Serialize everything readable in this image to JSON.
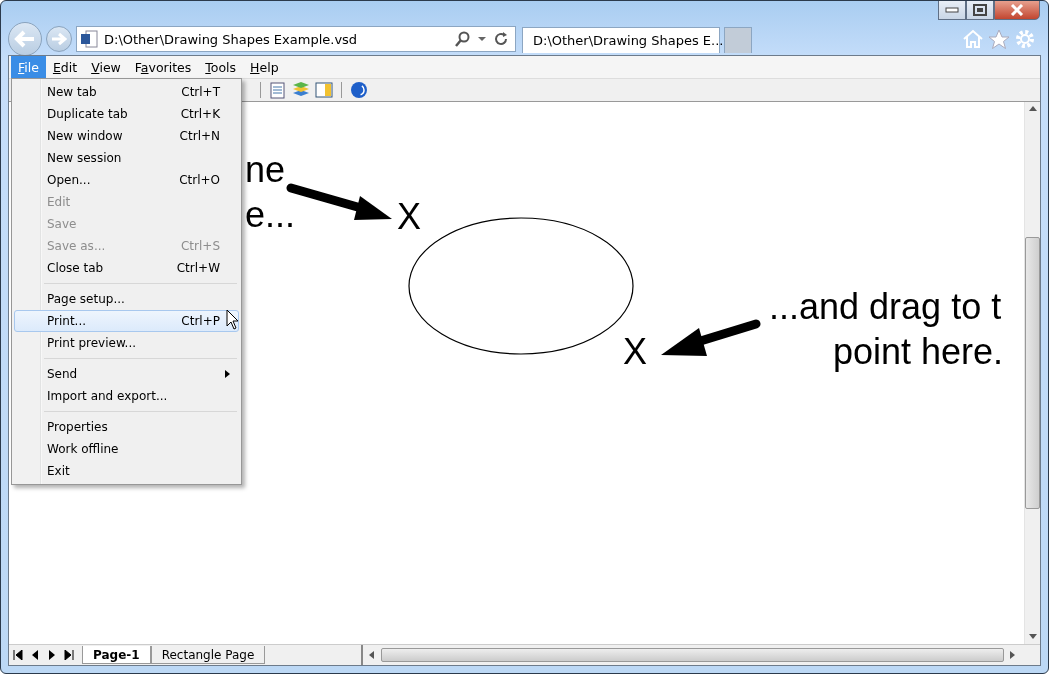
{
  "browser": {
    "address": "D:\\Other\\Drawing Shapes Example.vsd",
    "tabs": [
      {
        "title": "D:\\Other\\Drawing Shapes E...",
        "selected": true
      }
    ]
  },
  "menu_bar": [
    {
      "access_key": "F",
      "label_rest": "ile",
      "selected": true
    },
    {
      "access_key": "E",
      "label_rest": "dit",
      "selected": false
    },
    {
      "access_key": "V",
      "label_rest": "iew",
      "selected": false
    },
    {
      "label_start": "F",
      "access_key": "a",
      "label_rest": "vorites",
      "selected": false
    },
    {
      "access_key": "T",
      "label_rest": "ools",
      "selected": false
    },
    {
      "access_key": "H",
      "label_rest": "elp",
      "selected": false
    }
  ],
  "file_menu": [
    {
      "kind": "item",
      "label": "New tab",
      "shortcut": "Ctrl+T",
      "disabled": false,
      "selected": false
    },
    {
      "kind": "item",
      "label": "Duplicate tab",
      "shortcut": "Ctrl+K",
      "disabled": false,
      "selected": false
    },
    {
      "kind": "item",
      "label": "New window",
      "shortcut": "Ctrl+N",
      "disabled": false,
      "selected": false
    },
    {
      "kind": "item",
      "label": "New session",
      "disabled": false,
      "selected": false
    },
    {
      "kind": "item",
      "label": "Open...",
      "shortcut": "Ctrl+O",
      "disabled": false,
      "selected": false
    },
    {
      "kind": "item",
      "label": "Edit",
      "disabled": true,
      "selected": false
    },
    {
      "kind": "item",
      "label": "Save",
      "disabled": true,
      "selected": false
    },
    {
      "kind": "item",
      "label": "Save as...",
      "shortcut": "Ctrl+S",
      "disabled": true,
      "selected": false
    },
    {
      "kind": "item",
      "label": "Close tab",
      "shortcut": "Ctrl+W",
      "disabled": false,
      "selected": false
    },
    {
      "kind": "separator"
    },
    {
      "kind": "item",
      "label": "Page setup...",
      "disabled": false,
      "selected": false
    },
    {
      "kind": "item",
      "label": "Print...",
      "shortcut": "Ctrl+P",
      "disabled": false,
      "selected": true
    },
    {
      "kind": "item",
      "label": "Print preview...",
      "disabled": false,
      "selected": false
    },
    {
      "kind": "separator"
    },
    {
      "kind": "submenu",
      "label": "Send",
      "disabled": false,
      "selected": false
    },
    {
      "kind": "item",
      "label": "Import and export...",
      "disabled": false,
      "selected": false
    },
    {
      "kind": "separator"
    },
    {
      "kind": "item",
      "label": "Properties",
      "disabled": false,
      "selected": false
    },
    {
      "kind": "item",
      "label": "Work offline",
      "disabled": false,
      "selected": false
    },
    {
      "kind": "item",
      "label": "Exit",
      "disabled": false,
      "selected": false
    }
  ],
  "canvas": {
    "texts": [
      "ne",
      "e...",
      "X",
      "X",
      "...and drag to t",
      "point here."
    ]
  },
  "page_tabs": [
    {
      "label": "Page-1",
      "selected": true
    },
    {
      "label": "Rectangle Page",
      "selected": false
    }
  ]
}
